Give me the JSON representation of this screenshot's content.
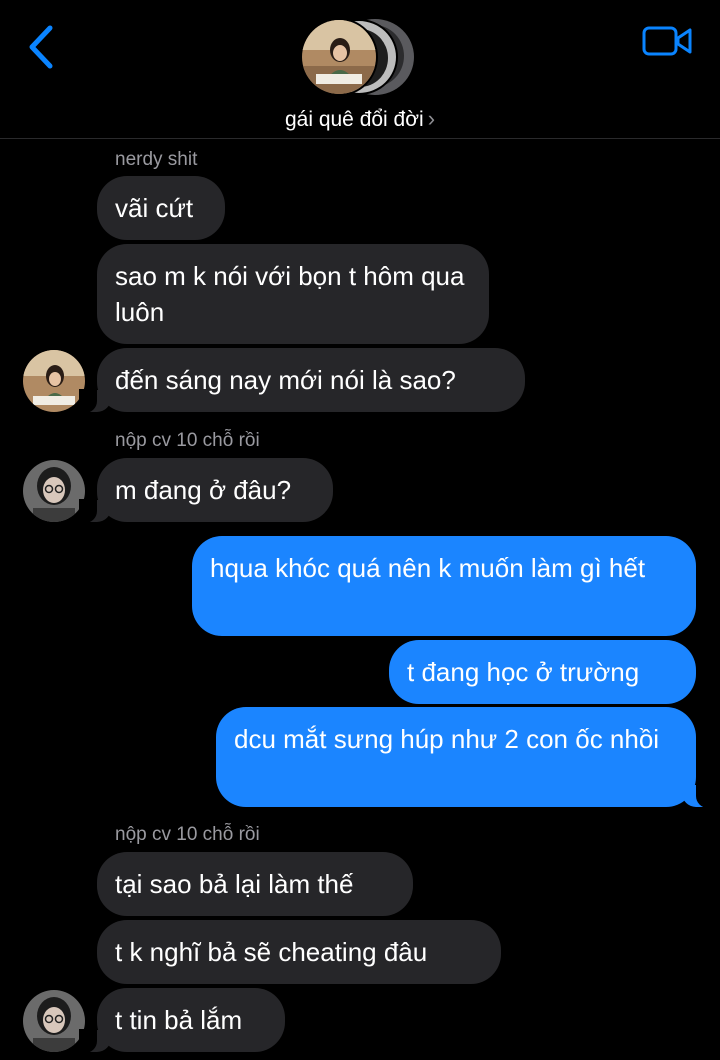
{
  "header": {
    "group_name": "gái quê đổi đời",
    "chevron": "›",
    "icons": [
      "back-chevron-icon",
      "video-call-icon",
      "chevron-right-icon"
    ]
  },
  "colors": {
    "background": "#000000",
    "sent_bubble": "#1b85ff",
    "received_bubble": "#262629",
    "accent": "#0a84ff",
    "sender_name": "#9a9aa0"
  },
  "messages": [
    {
      "sender": "nerdy shit",
      "direction": "received",
      "text": "vãi cứt"
    },
    {
      "direction": "received",
      "text": "sao m k nói với bọn t hôm qua luôn"
    },
    {
      "direction": "received",
      "text": "đến sáng nay mới nói là sao?"
    },
    {
      "sender": "nộp cv 10 chỗ rồi",
      "direction": "received",
      "text": "m đang ở đâu?"
    },
    {
      "direction": "sent",
      "text": "hqua khóc quá nên k muốn làm gì hết"
    },
    {
      "direction": "sent",
      "text": "t đang học ở trường"
    },
    {
      "direction": "sent",
      "text": "dcu mắt sưng húp như 2 con ốc nhồi"
    },
    {
      "sender": "nộp cv 10 chỗ rồi",
      "direction": "received",
      "text": "tại sao bả lại làm thế"
    },
    {
      "direction": "received",
      "text": "t k nghĩ bả sẽ cheating đâu"
    },
    {
      "direction": "received",
      "text": "t tin bả lắm"
    }
  ]
}
